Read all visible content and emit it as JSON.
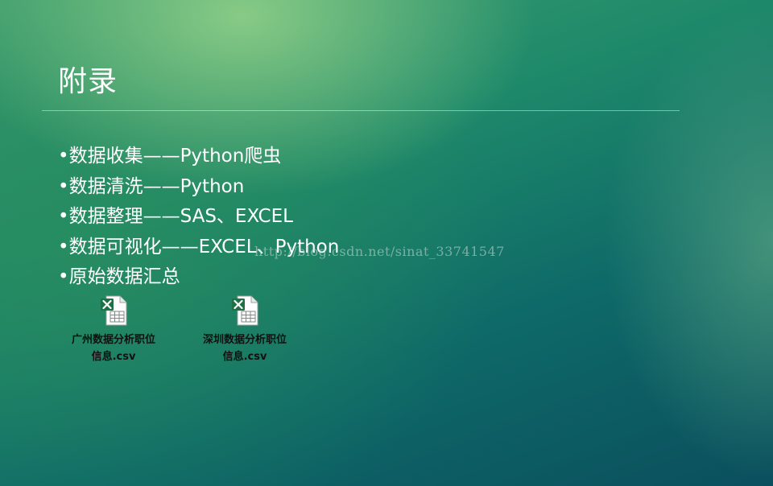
{
  "slide": {
    "title": "附录",
    "bullets": [
      "•数据收集——Python爬虫",
      "•数据清洗——Python",
      "•数据整理——SAS、EXCEL",
      "•数据可视化——EXCEL、Python",
      "•原始数据汇总"
    ]
  },
  "watermark": "http://blog.csdn.net/sinat_33741547",
  "attachments": [
    {
      "icon": "excel-csv-file-icon",
      "line1": "广州数据分析职位",
      "line2": "信息.csv"
    },
    {
      "icon": "excel-csv-file-icon",
      "line1": "深圳数据分析职位",
      "line2": "信息.csv"
    }
  ],
  "colors": {
    "excel_green": "#1e7145",
    "text": "#ffffff"
  }
}
